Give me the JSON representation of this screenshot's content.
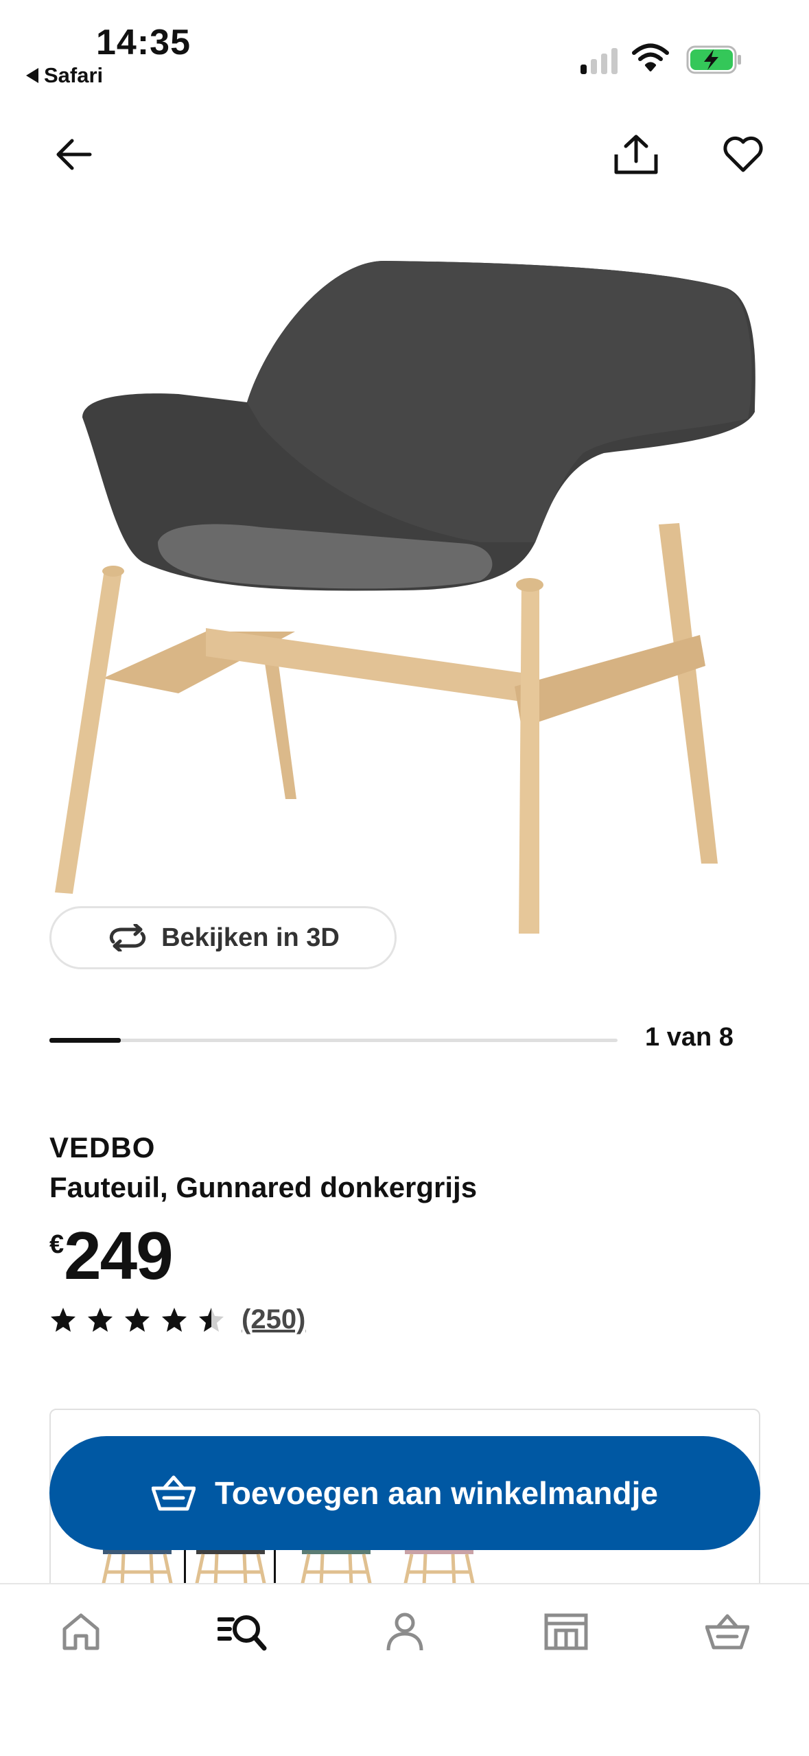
{
  "status_bar": {
    "time": "14:35",
    "back_app": "Safari"
  },
  "top_nav": {
    "back_icon": "arrow-left-icon",
    "share_icon": "share-icon",
    "favorite_icon": "heart-icon"
  },
  "product_image": {
    "alt": "chair-image"
  },
  "view_3d": {
    "label": "Bekijken in 3D",
    "icon": "rotate-icon"
  },
  "carousel": {
    "counter": "1 van 8",
    "position": 1,
    "total": 8
  },
  "product": {
    "brand": "VEDBO",
    "description": "Fauteuil, Gunnared donkergrijs",
    "currency": "€",
    "price": "249",
    "rating": 4.5,
    "review_count": "(250)"
  },
  "cta": {
    "label": "Toevoegen aan winkelmandje",
    "icon": "basket-icon"
  },
  "tab_bar": {
    "items": [
      {
        "icon": "home-icon",
        "active": false
      },
      {
        "icon": "search-icon",
        "active": true
      },
      {
        "icon": "profile-icon",
        "active": false
      },
      {
        "icon": "store-icon",
        "active": false
      },
      {
        "icon": "basket-icon",
        "active": false
      }
    ]
  },
  "colors": {
    "accent": "#0058a3",
    "text": "#111111",
    "muted": "#8c8c8c"
  }
}
